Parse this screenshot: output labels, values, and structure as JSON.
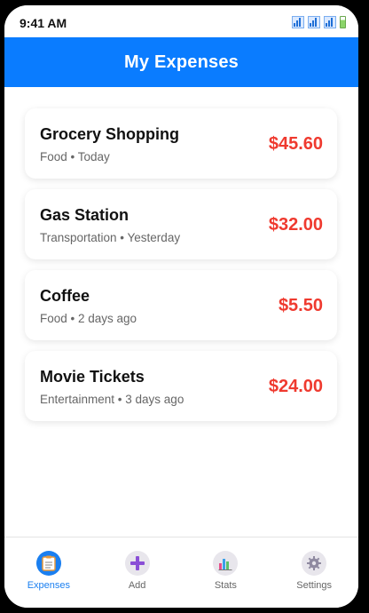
{
  "status_bar": {
    "time": "9:41 AM"
  },
  "header": {
    "title": "My Expenses"
  },
  "expenses": [
    {
      "title": "Grocery Shopping",
      "meta": "Food • Today",
      "amount": "$45.60"
    },
    {
      "title": "Gas Station",
      "meta": "Transportation • Yesterday",
      "amount": "$32.00"
    },
    {
      "title": "Coffee",
      "meta": "Food • 2 days ago",
      "amount": "$5.50"
    },
    {
      "title": "Movie Tickets",
      "meta": "Entertainment • 3 days ago",
      "amount": "$24.00"
    }
  ],
  "tabs": [
    {
      "label": "Expenses",
      "icon": "clipboard-icon",
      "active": true
    },
    {
      "label": "Add",
      "icon": "plus-icon",
      "active": false
    },
    {
      "label": "Stats",
      "icon": "bar-chart-icon",
      "active": false
    },
    {
      "label": "Settings",
      "icon": "gear-icon",
      "active": false
    }
  ],
  "colors": {
    "accent": "#0a7cff",
    "amount": "#ef3a2f"
  }
}
